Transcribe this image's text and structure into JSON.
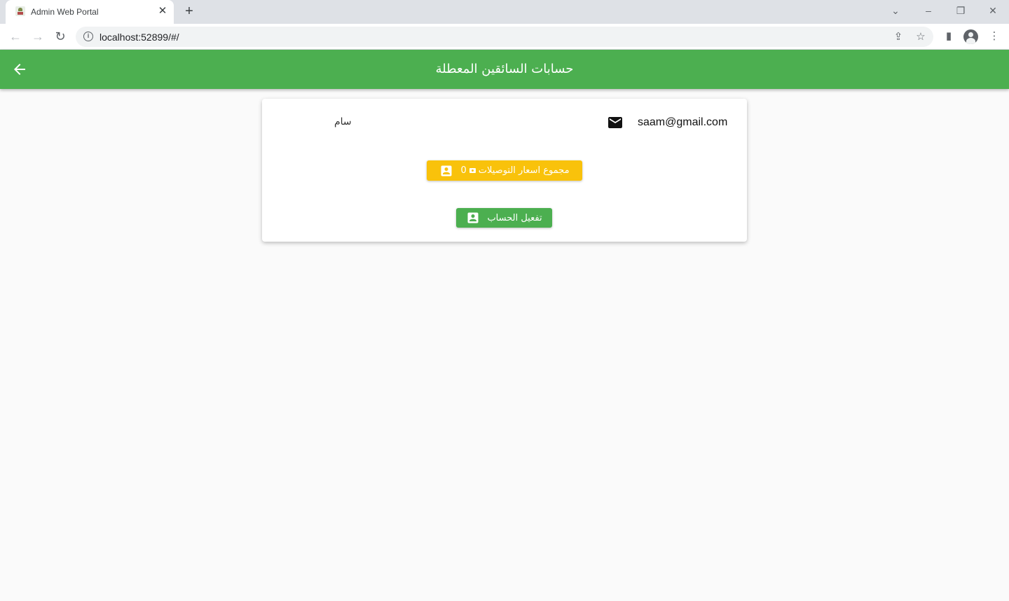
{
  "browser": {
    "tab_title": "Admin Web Portal",
    "url": "localhost:52899/#/"
  },
  "appbar": {
    "title": "حسابات السائقين المعطلة"
  },
  "driver_card": {
    "name": "سام",
    "email": "saam@gmail.com",
    "total_button": {
      "label": "مجموع اسعار التوصيلات",
      "amount": "0"
    },
    "activate_button": {
      "label": "تفعيل الحساب"
    }
  },
  "colors": {
    "appbar": "#4caf50",
    "total_button": "#f9c20b",
    "activate_button": "#4caf50"
  }
}
